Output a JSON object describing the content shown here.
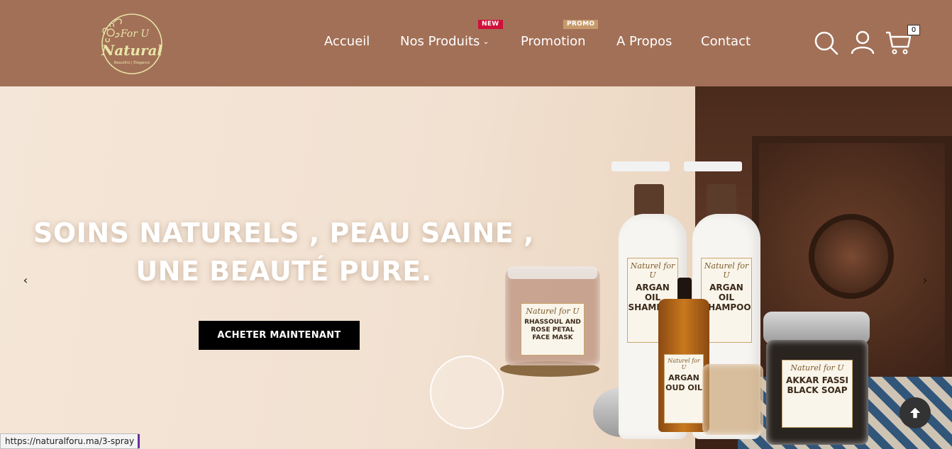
{
  "brand": {
    "logo_top": "For U",
    "logo_main": "Natural",
    "logo_tagline": "Beautiful | Elegance"
  },
  "nav": {
    "items": [
      {
        "label": "Accueil"
      },
      {
        "label": "Nos Produits"
      },
      {
        "label": "Promotion"
      },
      {
        "label": "A Propos"
      },
      {
        "label": "Contact"
      }
    ],
    "badge_new": "NEW",
    "badge_promo": "PROMO",
    "dropdown_icon": "chevron-down-icon"
  },
  "header_icons": {
    "search": "search-icon",
    "account": "user-icon",
    "cart": "cart-icon",
    "cart_count": "0"
  },
  "hero": {
    "headline": "SOINS NATURELS , PEAU SAINE , UNE BEAUTÉ PURE.",
    "cta_label": "ACHETER MAINTENANT",
    "prev_arrow": "‹",
    "next_arrow": "›",
    "products": {
      "jar_brand": "Naturel for U",
      "jar_name": "RHASSOUL AND ROSE PETAL FACE MASK",
      "shampoo_brand": "Naturel for U",
      "shampoo_name": "ARGAN OIL SHAMPOO",
      "oil_brand": "Naturel for U",
      "oil_name": "ARGAN OUD OIL",
      "soap_brand": "Naturel for U",
      "soap_name": "AKKAR FASSI BLACK SOAP"
    }
  },
  "status_url": "https://naturalforu.ma/3-spray",
  "colors": {
    "header_bg": "#a27057",
    "badge_new": "#d0103a",
    "badge_promo": "#c79a6c",
    "cta_bg": "#000000"
  }
}
